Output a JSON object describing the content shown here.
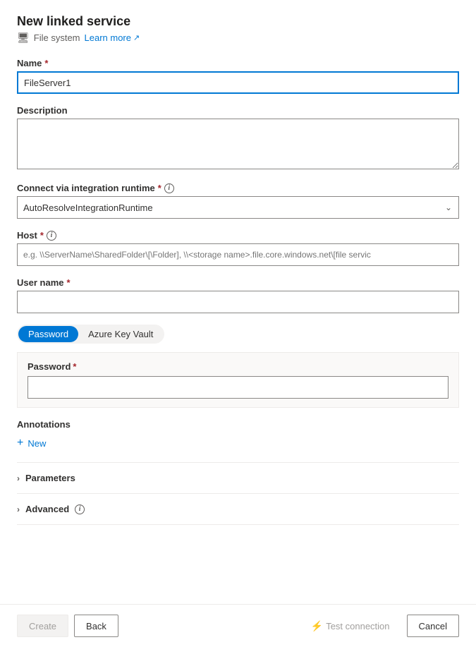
{
  "page": {
    "title": "New linked service",
    "subtitle": "File system",
    "learn_more": "Learn more"
  },
  "form": {
    "name_label": "Name",
    "name_value": "FileServer1",
    "description_label": "Description",
    "description_placeholder": "",
    "integration_runtime_label": "Connect via integration runtime",
    "integration_runtime_value": "AutoResolveIntegrationRuntime",
    "host_label": "Host",
    "host_placeholder": "e.g. \\\\ServerName\\SharedFolder\\[\\Folder], \\\\<storage name>.file.core.windows.net\\[file servic",
    "username_label": "User name",
    "username_value": "",
    "password_tab": "Password",
    "azure_key_vault_tab": "Azure Key Vault",
    "password_label": "Password",
    "password_value": "",
    "annotations_label": "Annotations",
    "new_label": "New",
    "parameters_label": "Parameters",
    "advanced_label": "Advanced"
  },
  "footer": {
    "create_label": "Create",
    "back_label": "Back",
    "test_connection_label": "Test connection",
    "cancel_label": "Cancel"
  },
  "icons": {
    "file_system": "🖥",
    "external_link": "↗",
    "chevron_down": "⌄",
    "chevron_right": "›",
    "plus": "+",
    "info": "i",
    "plug": "⚡"
  }
}
